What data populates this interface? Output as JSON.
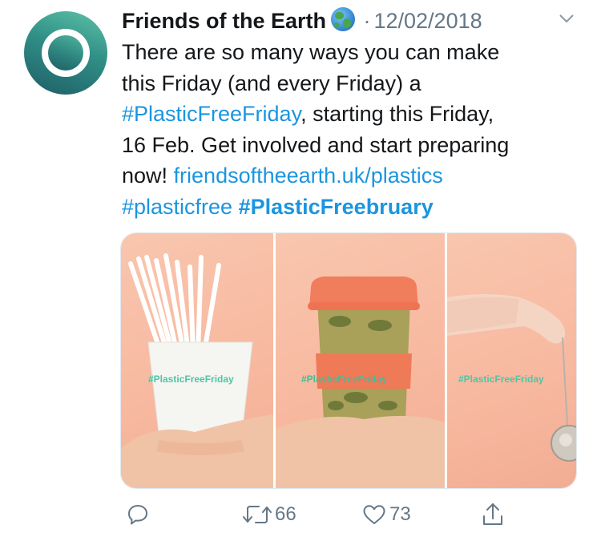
{
  "tweet": {
    "author": "Friends of the Earth",
    "separator": "·",
    "date": "12/02/2018",
    "text_line1": "There are so many ways you can make",
    "text_line2": "this Friday (and every Friday) a",
    "hashtag1": "#PlasticFreeFriday",
    "text_line3_rest": ", starting this Friday,",
    "text_line4": "16 Feb. Get involved and start preparing",
    "text_line5_start": "now! ",
    "link": "friendsoftheearth.uk/plastics",
    "hashtag2": "#plasticfree",
    "hashtag3": "#PlasticFreebruary"
  },
  "media": {
    "overlay_1": "#PlasticFreeFriday",
    "overlay_2": "#PlasticFreeFriday",
    "overlay_3": "#PlasticFreeFriday"
  },
  "actions": {
    "retweets": "66",
    "likes": "73"
  },
  "colors": {
    "link": "#1b95e0",
    "muted": "#657786",
    "brand_green": "#4ec6a3",
    "panel_peach": "#f7b89f"
  },
  "icons": [
    "globe-icon",
    "chevron-down-icon",
    "reply-icon",
    "retweet-icon",
    "like-icon",
    "share-icon"
  ]
}
